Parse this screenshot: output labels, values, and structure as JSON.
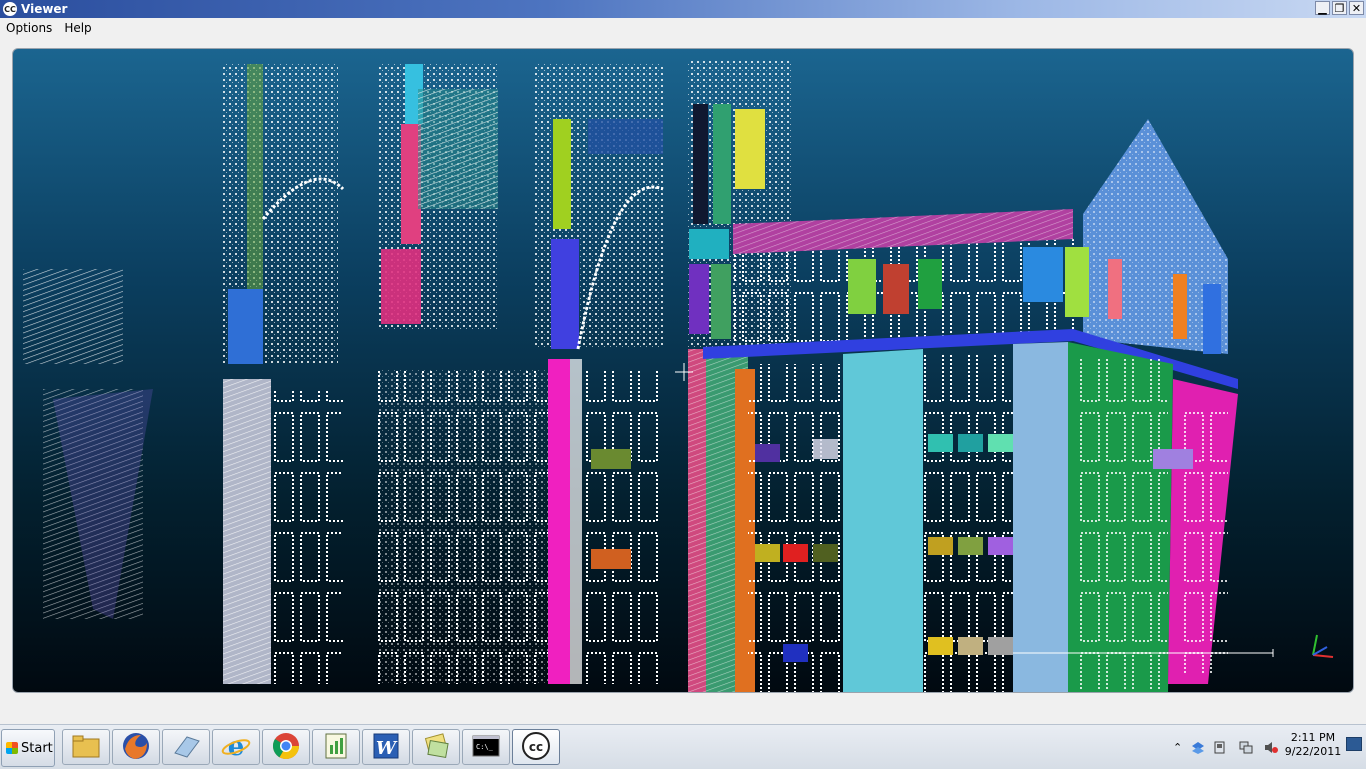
{
  "window": {
    "title": "Viewer",
    "app_icon_text": "CC",
    "controls": {
      "minimize": "▁",
      "restore": "❐",
      "close": "✕"
    }
  },
  "menu": [
    {
      "label": "Options"
    },
    {
      "label": "Help"
    }
  ],
  "viewport": {
    "content": "colored point cloud of building facades",
    "background_top": "#1b6590",
    "background_bottom": "#010910",
    "axis_colors": {
      "x": "#e03030",
      "y": "#30c030",
      "z": "#3060e0"
    }
  },
  "taskbar": {
    "start_label": "Start",
    "buttons": [
      {
        "name": "file-explorer",
        "icon": "folder-icon"
      },
      {
        "name": "firefox",
        "icon": "firefox-icon"
      },
      {
        "name": "eraser-app",
        "icon": "eraser-icon"
      },
      {
        "name": "internet-explorer",
        "icon": "ie-icon"
      },
      {
        "name": "chrome",
        "icon": "chrome-icon"
      },
      {
        "name": "notepad",
        "icon": "notepad-icon"
      },
      {
        "name": "word",
        "icon": "word-icon"
      },
      {
        "name": "folders",
        "icon": "folders-icon"
      },
      {
        "name": "command-prompt",
        "icon": "cmd-icon"
      },
      {
        "name": "cloudcompare",
        "icon": "cc-icon",
        "active": true
      }
    ],
    "clock": {
      "time": "2:11 PM",
      "date": "9/22/2011"
    }
  }
}
